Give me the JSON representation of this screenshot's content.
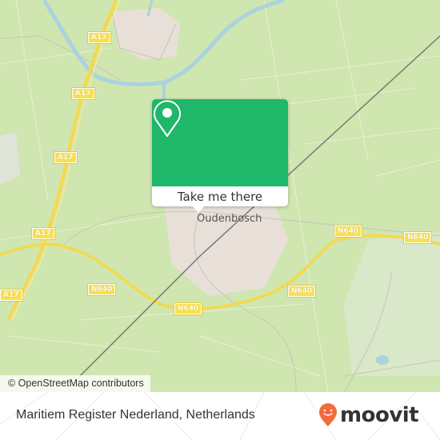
{
  "map": {
    "place_label": "Oudenbosch",
    "road_shields": [
      {
        "label": "A17"
      },
      {
        "label": "A17"
      },
      {
        "label": "A17"
      },
      {
        "label": "A17"
      },
      {
        "label": "A17"
      },
      {
        "label": "N640"
      },
      {
        "label": "N640"
      },
      {
        "label": "N640"
      },
      {
        "label": "N640"
      },
      {
        "label": "N640"
      }
    ],
    "attribution": "© OpenStreetMap contributors",
    "colors": {
      "land": "#cfe6b0",
      "water": "#aad3df",
      "road_major": "#f9e24b",
      "urban": "#e8e0d8",
      "accent": "#1fb76a"
    }
  },
  "popup": {
    "icon": "location-pin-icon",
    "button_label": "Take me there"
  },
  "footer": {
    "title": "Maritiem Register Nederland, Netherlands",
    "logo_text": "moovit",
    "logo_icon": "moovit-pin-icon"
  }
}
